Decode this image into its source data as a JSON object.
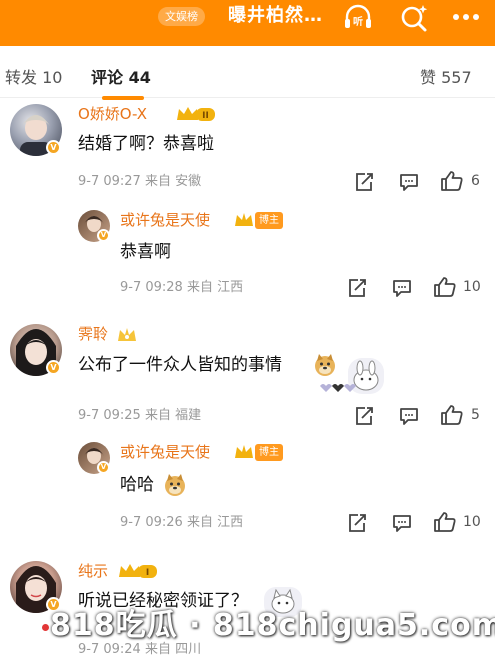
{
  "header": {
    "tag": "文娱榜",
    "title": "曝井柏然…",
    "listen_icon": "listen-icon",
    "search_icon": "search-sparkle-icon",
    "more_icon": "more-icon"
  },
  "tabs": [
    {
      "label": "转发 10"
    },
    {
      "label": "评论 44"
    },
    {
      "label": "赞 557"
    }
  ],
  "comments": [
    {
      "name": "O娇娇O-X",
      "level": "II",
      "text": "结婚了啊？恭喜啦",
      "meta": "9-7 09:27 来自 安徽",
      "likes": "6",
      "reply": {
        "name": "或许兔是天使",
        "badge": "博主",
        "text": "恭喜啊",
        "meta": "9-7 09:28 来自 江西",
        "likes": "10"
      }
    },
    {
      "name": "霁聆",
      "text": "公布了一件众人皆知的事情",
      "meta": "9-7 09:25 来自 福建",
      "likes": "5",
      "reply": {
        "name": "或许兔是天使",
        "badge": "博主",
        "text": "哈哈",
        "meta": "9-7 09:26 来自 江西",
        "likes": "10"
      }
    },
    {
      "name": "纯示",
      "level": "I",
      "text": "听说已经秘密领证了？",
      "meta": "9-7 09:24 来自 四川"
    }
  ],
  "watermark": "818吃瓜 · 818chigua5.com",
  "colors": {
    "accent": "#ff8a00",
    "name": "#e8751a",
    "meta": "#999999"
  }
}
